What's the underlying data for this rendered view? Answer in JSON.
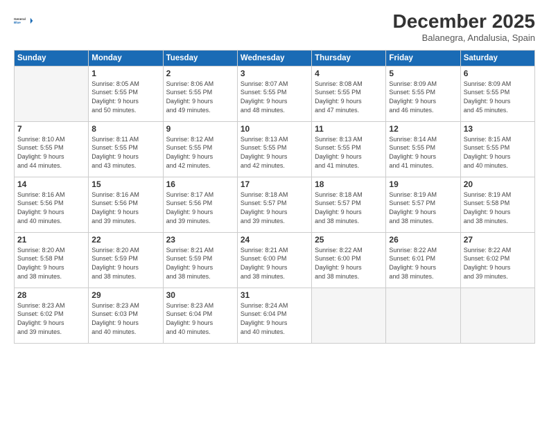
{
  "logo": {
    "line1": "General",
    "line2": "Blue"
  },
  "header": {
    "month": "December 2025",
    "location": "Balanegra, Andalusia, Spain"
  },
  "weekdays": [
    "Sunday",
    "Monday",
    "Tuesday",
    "Wednesday",
    "Thursday",
    "Friday",
    "Saturday"
  ],
  "weeks": [
    [
      {
        "day": "",
        "info": ""
      },
      {
        "day": "1",
        "info": "Sunrise: 8:05 AM\nSunset: 5:55 PM\nDaylight: 9 hours\nand 50 minutes."
      },
      {
        "day": "2",
        "info": "Sunrise: 8:06 AM\nSunset: 5:55 PM\nDaylight: 9 hours\nand 49 minutes."
      },
      {
        "day": "3",
        "info": "Sunrise: 8:07 AM\nSunset: 5:55 PM\nDaylight: 9 hours\nand 48 minutes."
      },
      {
        "day": "4",
        "info": "Sunrise: 8:08 AM\nSunset: 5:55 PM\nDaylight: 9 hours\nand 47 minutes."
      },
      {
        "day": "5",
        "info": "Sunrise: 8:09 AM\nSunset: 5:55 PM\nDaylight: 9 hours\nand 46 minutes."
      },
      {
        "day": "6",
        "info": "Sunrise: 8:09 AM\nSunset: 5:55 PM\nDaylight: 9 hours\nand 45 minutes."
      }
    ],
    [
      {
        "day": "7",
        "info": "Sunrise: 8:10 AM\nSunset: 5:55 PM\nDaylight: 9 hours\nand 44 minutes."
      },
      {
        "day": "8",
        "info": "Sunrise: 8:11 AM\nSunset: 5:55 PM\nDaylight: 9 hours\nand 43 minutes."
      },
      {
        "day": "9",
        "info": "Sunrise: 8:12 AM\nSunset: 5:55 PM\nDaylight: 9 hours\nand 42 minutes."
      },
      {
        "day": "10",
        "info": "Sunrise: 8:13 AM\nSunset: 5:55 PM\nDaylight: 9 hours\nand 42 minutes."
      },
      {
        "day": "11",
        "info": "Sunrise: 8:13 AM\nSunset: 5:55 PM\nDaylight: 9 hours\nand 41 minutes."
      },
      {
        "day": "12",
        "info": "Sunrise: 8:14 AM\nSunset: 5:55 PM\nDaylight: 9 hours\nand 41 minutes."
      },
      {
        "day": "13",
        "info": "Sunrise: 8:15 AM\nSunset: 5:55 PM\nDaylight: 9 hours\nand 40 minutes."
      }
    ],
    [
      {
        "day": "14",
        "info": "Sunrise: 8:16 AM\nSunset: 5:56 PM\nDaylight: 9 hours\nand 40 minutes."
      },
      {
        "day": "15",
        "info": "Sunrise: 8:16 AM\nSunset: 5:56 PM\nDaylight: 9 hours\nand 39 minutes."
      },
      {
        "day": "16",
        "info": "Sunrise: 8:17 AM\nSunset: 5:56 PM\nDaylight: 9 hours\nand 39 minutes."
      },
      {
        "day": "17",
        "info": "Sunrise: 8:18 AM\nSunset: 5:57 PM\nDaylight: 9 hours\nand 39 minutes."
      },
      {
        "day": "18",
        "info": "Sunrise: 8:18 AM\nSunset: 5:57 PM\nDaylight: 9 hours\nand 38 minutes."
      },
      {
        "day": "19",
        "info": "Sunrise: 8:19 AM\nSunset: 5:57 PM\nDaylight: 9 hours\nand 38 minutes."
      },
      {
        "day": "20",
        "info": "Sunrise: 8:19 AM\nSunset: 5:58 PM\nDaylight: 9 hours\nand 38 minutes."
      }
    ],
    [
      {
        "day": "21",
        "info": "Sunrise: 8:20 AM\nSunset: 5:58 PM\nDaylight: 9 hours\nand 38 minutes."
      },
      {
        "day": "22",
        "info": "Sunrise: 8:20 AM\nSunset: 5:59 PM\nDaylight: 9 hours\nand 38 minutes."
      },
      {
        "day": "23",
        "info": "Sunrise: 8:21 AM\nSunset: 5:59 PM\nDaylight: 9 hours\nand 38 minutes."
      },
      {
        "day": "24",
        "info": "Sunrise: 8:21 AM\nSunset: 6:00 PM\nDaylight: 9 hours\nand 38 minutes."
      },
      {
        "day": "25",
        "info": "Sunrise: 8:22 AM\nSunset: 6:00 PM\nDaylight: 9 hours\nand 38 minutes."
      },
      {
        "day": "26",
        "info": "Sunrise: 8:22 AM\nSunset: 6:01 PM\nDaylight: 9 hours\nand 38 minutes."
      },
      {
        "day": "27",
        "info": "Sunrise: 8:22 AM\nSunset: 6:02 PM\nDaylight: 9 hours\nand 39 minutes."
      }
    ],
    [
      {
        "day": "28",
        "info": "Sunrise: 8:23 AM\nSunset: 6:02 PM\nDaylight: 9 hours\nand 39 minutes."
      },
      {
        "day": "29",
        "info": "Sunrise: 8:23 AM\nSunset: 6:03 PM\nDaylight: 9 hours\nand 40 minutes."
      },
      {
        "day": "30",
        "info": "Sunrise: 8:23 AM\nSunset: 6:04 PM\nDaylight: 9 hours\nand 40 minutes."
      },
      {
        "day": "31",
        "info": "Sunrise: 8:24 AM\nSunset: 6:04 PM\nDaylight: 9 hours\nand 40 minutes."
      },
      {
        "day": "",
        "info": ""
      },
      {
        "day": "",
        "info": ""
      },
      {
        "day": "",
        "info": ""
      }
    ]
  ]
}
